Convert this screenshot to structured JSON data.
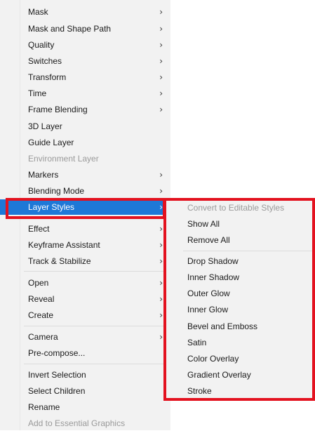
{
  "main_menu": {
    "items": [
      {
        "label": "Mask",
        "arrow": "›"
      },
      {
        "label": "Mask and Shape Path",
        "arrow": "›"
      },
      {
        "label": "Quality",
        "arrow": "›"
      },
      {
        "label": "Switches",
        "arrow": "›"
      },
      {
        "label": "Transform",
        "arrow": "›"
      },
      {
        "label": "Time",
        "arrow": "›"
      },
      {
        "label": "Frame Blending",
        "arrow": "›"
      },
      {
        "label": "3D Layer"
      },
      {
        "label": "Guide Layer"
      },
      {
        "label": "Environment Layer",
        "disabled": true
      },
      {
        "label": "Markers",
        "arrow": "›"
      },
      {
        "label": "Blending Mode",
        "arrow": "›"
      },
      {
        "label": "Layer Styles",
        "arrow": "›",
        "highlighted": true
      },
      {
        "label": "Effect",
        "arrow": "›"
      },
      {
        "label": "Keyframe Assistant",
        "arrow": "›"
      },
      {
        "label": "Track & Stabilize",
        "arrow": "›"
      },
      {
        "label": "Open",
        "arrow": "›"
      },
      {
        "label": "Reveal",
        "arrow": "›"
      },
      {
        "label": "Create",
        "arrow": "›"
      },
      {
        "label": "Camera",
        "arrow": "›"
      },
      {
        "label": "Pre-compose..."
      },
      {
        "label": "Invert Selection"
      },
      {
        "label": "Select Children"
      },
      {
        "label": "Rename"
      },
      {
        "label": "Add to Essential Graphics",
        "disabled": true
      }
    ]
  },
  "submenu": {
    "items": [
      {
        "label": "Convert to Editable Styles",
        "disabled": true
      },
      {
        "label": "Show All"
      },
      {
        "label": "Remove All"
      },
      {
        "label": "Drop Shadow"
      },
      {
        "label": "Inner Shadow"
      },
      {
        "label": "Outer Glow"
      },
      {
        "label": "Inner Glow"
      },
      {
        "label": "Bevel and Emboss"
      },
      {
        "label": "Satin"
      },
      {
        "label": "Color Overlay"
      },
      {
        "label": "Gradient Overlay"
      },
      {
        "label": "Stroke"
      }
    ]
  },
  "colors": {
    "highlight": "#1e78d7",
    "annotation_red": "#e3121f",
    "menu_bg": "#f2f2f2",
    "disabled_text": "#9a9a9a"
  }
}
